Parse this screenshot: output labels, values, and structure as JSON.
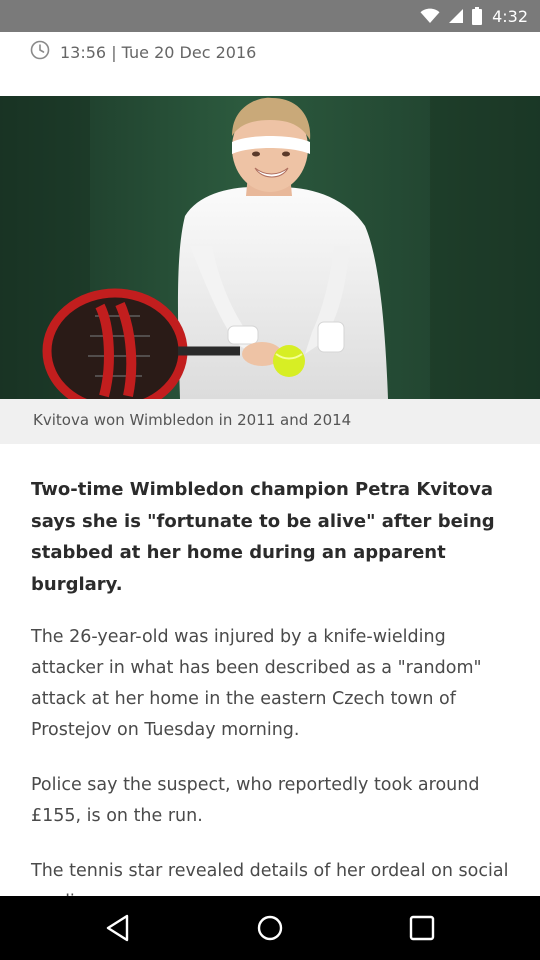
{
  "status_bar": {
    "time": "4:32",
    "icons": [
      "wifi-icon",
      "signal-icon",
      "battery-icon"
    ]
  },
  "article": {
    "timestamp": "13:56 | Tue 20 Dec 2016",
    "image_caption": "Kvitova won Wimbledon in 2011 and 2014",
    "lead": "Two-time Wimbledon champion Petra Kvitova says she is \"fortunate to be alive\" after being stabbed at her home during an apparent burglary.",
    "paragraphs": [
      "The 26-year-old was injured by a knife-wielding attacker in what has been described as a \"random\" attack at her home in the eastern Czech town of Prostejov on Tuesday morning.",
      "Police say the suspect, who reportedly took around £155, is on the run.",
      "The tennis star revealed details of her ordeal on social media."
    ]
  },
  "nav_bar": {
    "buttons": [
      "back-icon",
      "home-icon",
      "recents-icon"
    ]
  }
}
